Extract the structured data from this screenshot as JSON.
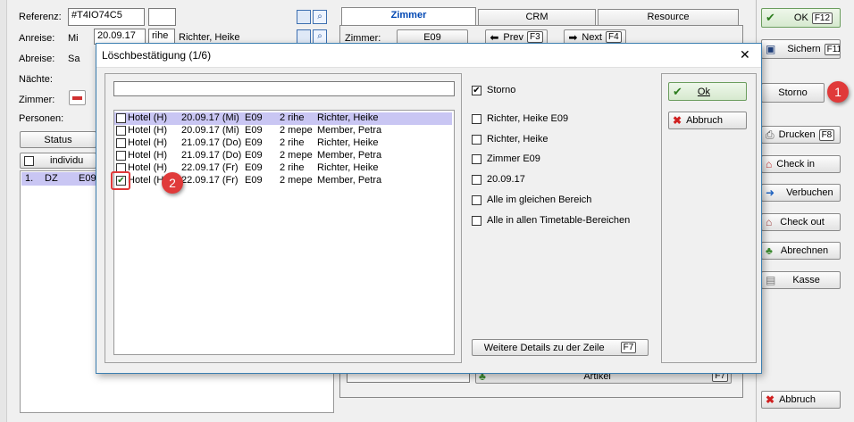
{
  "main_form": {
    "referenz_label": "Referenz:",
    "referenz_value": "#T4IO74C5",
    "anreise_label": "Anreise:",
    "anreise_day": "Mi",
    "anreise_date": "20.09.17",
    "anreise_code": "rihe",
    "anreise_name": "Richter, Heike",
    "abreise_label": "Abreise:",
    "abreise_day": "Sa",
    "naechte_label": "Nächte:",
    "zimmer_label": "Zimmer:",
    "personen_label": "Personen:",
    "status_label": "Status",
    "individual_label": "individu",
    "row_num": "1.",
    "row_type": "DZ",
    "row_room": "E09"
  },
  "tabs": [
    {
      "label": "Zimmer"
    },
    {
      "label": "CRM"
    },
    {
      "label": "Resource"
    }
  ],
  "room_bar": {
    "zimmer_label": "Zimmer:",
    "zimmer_value": "E09",
    "prev_label": "Prev",
    "prev_key": "F3",
    "next_label": "Next",
    "next_key": "F4"
  },
  "bottom_bar": {
    "artikel_label": "Artikel",
    "artikel_key": "F7"
  },
  "right_panel": {
    "ok_label": "OK",
    "ok_key": "F12",
    "sichern_label": "Sichern",
    "sichern_key": "F11",
    "storno_label": "Storno",
    "drucken_label": "Drucken",
    "drucken_key": "F8",
    "checkin_label": "Check in",
    "verbuchen_label": "Verbuchen",
    "checkout_label": "Check out",
    "abrechnen_label": "Abrechnen",
    "kasse_label": "Kasse",
    "abbruch_label": "Abbruch"
  },
  "dialog": {
    "title": "Löschbestätigung (1/6)",
    "close": "✕",
    "search_value": "",
    "rows": [
      {
        "c1": "Hotel (H)",
        "c2": "20.09.17 (Mi)",
        "c3": "E09",
        "c4": "2 rihe",
        "c5": "Richter, Heike",
        "checked": false,
        "selected": true
      },
      {
        "c1": "Hotel (H)",
        "c2": "20.09.17 (Mi)",
        "c3": "E09",
        "c4": "2 mepe",
        "c5": "Member, Petra",
        "checked": false,
        "selected": false
      },
      {
        "c1": "Hotel (H)",
        "c2": "21.09.17 (Do)",
        "c3": "E09",
        "c4": "2 rihe",
        "c5": "Richter, Heike",
        "checked": false,
        "selected": false
      },
      {
        "c1": "Hotel (H)",
        "c2": "21.09.17 (Do)",
        "c3": "E09",
        "c4": "2 mepe",
        "c5": "Member, Petra",
        "checked": false,
        "selected": false
      },
      {
        "c1": "Hotel (H)",
        "c2": "22.09.17 (Fr)",
        "c3": "E09",
        "c4": "2 rihe",
        "c5": "Richter, Heike",
        "checked": false,
        "selected": false
      },
      {
        "c1": "Hotel (H)",
        "c2": "22.09.17 (Fr)",
        "c3": "E09",
        "c4": "2 mepe",
        "c5": "Member, Petra",
        "checked": true,
        "selected": false
      }
    ],
    "options": [
      {
        "label": "Storno",
        "checked": true
      },
      {
        "label": "Richter, Heike E09",
        "checked": false
      },
      {
        "label": "Richter, Heike",
        "checked": false
      },
      {
        "label": "Zimmer E09",
        "checked": false
      },
      {
        "label": "20.09.17",
        "checked": false
      },
      {
        "label": "Alle im gleichen Bereich",
        "checked": false
      },
      {
        "label": "Alle in allen Timetable-Bereichen",
        "checked": false
      }
    ],
    "details_label": "Weitere Details zu der Zeile",
    "details_key": "F7",
    "ok_label": "Ok",
    "abbruch_label": "Abbruch"
  },
  "annotations": {
    "one": "1",
    "two": "2"
  },
  "colors": {
    "selected_row": "#c9c6f3",
    "badge": "#e03a3a",
    "accent_tab": "#0047b3"
  }
}
